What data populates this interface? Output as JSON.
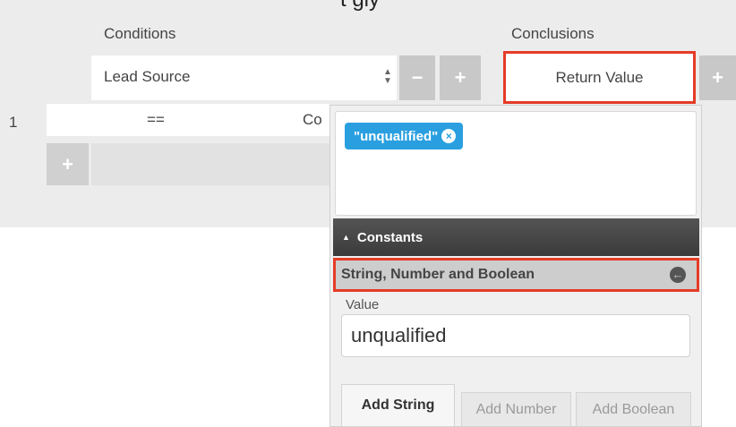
{
  "top_fragment": "t gly",
  "headers": {
    "conditions": "Conditions",
    "conclusions": "Conclusions"
  },
  "condition_field": {
    "value": "Lead Source",
    "icon": "sort-arrows-icon"
  },
  "buttons": {
    "minus": "−",
    "plus": "+",
    "add_row": "+"
  },
  "conclusion_field": {
    "label": "Return Value"
  },
  "row": {
    "number": "1",
    "operator": "==",
    "value_cut": "Co"
  },
  "popover": {
    "tag_label": "\"unqualified\"",
    "tag_remove": "×",
    "constants_header": "Constants",
    "constants_arrow": "▲",
    "section_title": "String, Number and Boolean",
    "back_icon": "←",
    "value_label": "Value",
    "value_input": "unqualified",
    "add_string": "Add String",
    "add_number": "Add Number",
    "add_boolean": "Add Boolean"
  },
  "colors": {
    "accent_red": "#e53b26",
    "tag_blue": "#2a9fe0",
    "button_grey": "#c8c8c8"
  }
}
